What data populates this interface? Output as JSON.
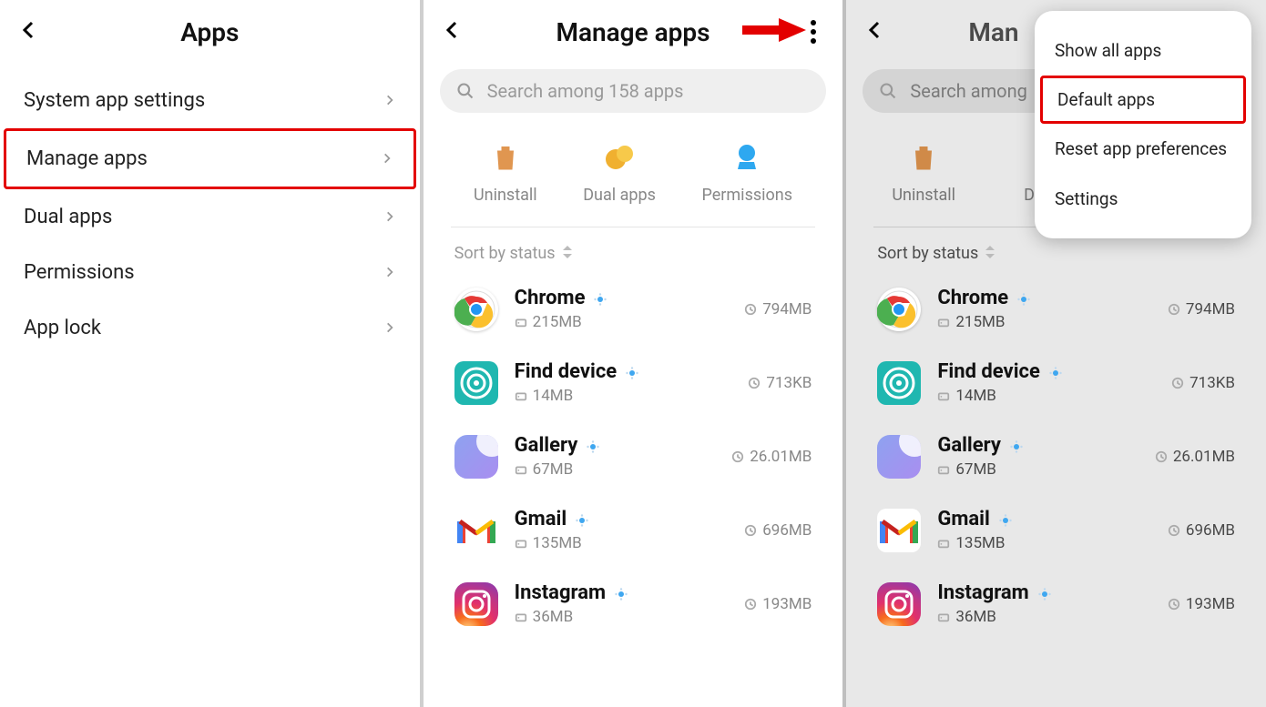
{
  "panel1": {
    "title": "Apps",
    "items": [
      {
        "label": "System app settings",
        "highlight": false
      },
      {
        "label": "Manage apps",
        "highlight": true
      },
      {
        "label": "Dual apps",
        "highlight": false
      },
      {
        "label": "Permissions",
        "highlight": false
      },
      {
        "label": "App lock",
        "highlight": false
      }
    ]
  },
  "panel2": {
    "title": "Manage apps",
    "search_placeholder": "Search among 158 apps",
    "actions": [
      {
        "label": "Uninstall"
      },
      {
        "label": "Dual apps"
      },
      {
        "label": "Permissions"
      }
    ],
    "sort_label": "Sort by status",
    "apps": [
      {
        "name": "Chrome",
        "size": "215MB",
        "time": "794MB",
        "icon": "chrome"
      },
      {
        "name": "Find device",
        "size": "14MB",
        "time": "713KB",
        "icon": "find"
      },
      {
        "name": "Gallery",
        "size": "67MB",
        "time": "26.01MB",
        "icon": "gallery"
      },
      {
        "name": "Gmail",
        "size": "135MB",
        "time": "696MB",
        "icon": "gmail"
      },
      {
        "name": "Instagram",
        "size": "36MB",
        "time": "193MB",
        "icon": "insta"
      }
    ]
  },
  "panel3": {
    "title_visible": "Man",
    "search_placeholder_visible": "Search among",
    "actions": [
      {
        "label": "Uninstall"
      },
      {
        "label_visible": "D"
      }
    ],
    "sort_label": "Sort by status",
    "apps": [
      {
        "name": "Chrome",
        "size": "215MB",
        "time": "794MB",
        "icon": "chrome"
      },
      {
        "name": "Find device",
        "size": "14MB",
        "time": "713KB",
        "icon": "find"
      },
      {
        "name": "Gallery",
        "size": "67MB",
        "time": "26.01MB",
        "icon": "gallery"
      },
      {
        "name": "Gmail",
        "size": "135MB",
        "time": "696MB",
        "icon": "gmail"
      },
      {
        "name": "Instagram",
        "size": "36MB",
        "time": "193MB",
        "icon": "insta"
      }
    ],
    "popup": [
      {
        "label": "Show all apps",
        "highlight": false
      },
      {
        "label": "Default apps",
        "highlight": true
      },
      {
        "label": "Reset app preferences",
        "highlight": false
      },
      {
        "label": "Settings",
        "highlight": false
      }
    ]
  }
}
